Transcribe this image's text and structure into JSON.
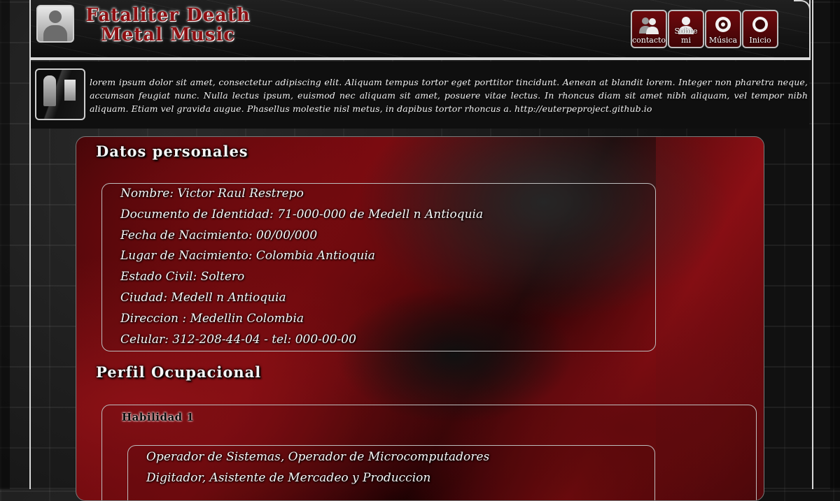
{
  "header": {
    "logo_line1": "Fataliter Death",
    "logo_line2": "Metal Music",
    "nav": [
      {
        "label": "contacto",
        "icon": "contacts-icon"
      },
      {
        "label": "Sobre mi",
        "icon": "user-icon"
      },
      {
        "label": "Música",
        "icon": "music-target-icon"
      },
      {
        "label": "Inicio",
        "icon": "home-ring-icon"
      }
    ]
  },
  "intro": {
    "text": "lorem ipsum dolor sit amet, consectetur adipiscing elit. Aliquam tempus tortor eget porttitor tincidunt. Aenean at blandit lorem. Integer non pharetra neque, accumsan feugiat nunc. Nulla lectus ipsum, euismod nec aliquam sit amet, posuere vitae lectus. In rhoncus diam sit amet nibh aliquam, vel tempor nibh aliquam. Etiam vel gravida augue. Phasellus molestie nisl metus, in dapibus tortor rhoncus a. http://euterpeproject.github.io"
  },
  "personal": {
    "title": "Datos personales",
    "lines": [
      "Nombre: Victor Raul Restrepo",
      "Documento de Identidad: 71-000-000 de Medell n Antioquia",
      "Fecha de Nacimiento: 00/00/000",
      "Lugar de Nacimiento: Colombia Antioquia",
      "Estado Civil: Soltero",
      "Ciudad: Medell n Antioquia",
      "Direccion : Medellin Colombia",
      "Celular: 312-208-44-04 - tel: 000-00-00"
    ]
  },
  "profile": {
    "title": "Perfil Ocupacional",
    "subtitle": "Habilidad 1",
    "lines": [
      "Operador de Sistemas, Operador de Microcomputadores",
      "Digitador, Asistente de Mercadeo y Produccion"
    ]
  },
  "colors": {
    "accent_red": "#7a0a0f",
    "nav_red": "#6d0a0d",
    "frame_gray": "#d8d8d8"
  }
}
